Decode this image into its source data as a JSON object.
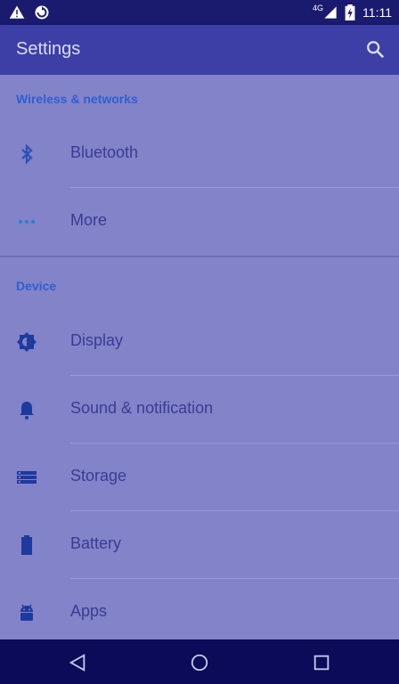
{
  "status_bar": {
    "network": "4G",
    "time": "11:11"
  },
  "app_bar": {
    "title": "Settings"
  },
  "sections": {
    "wireless": {
      "header": "Wireless & networks",
      "items": [
        {
          "label": "Bluetooth",
          "icon": "bluetooth-icon"
        },
        {
          "label": "More",
          "icon": "more-icon"
        }
      ]
    },
    "device": {
      "header": "Device",
      "items": [
        {
          "label": "Display",
          "icon": "display-icon"
        },
        {
          "label": "Sound & notification",
          "icon": "bell-icon"
        },
        {
          "label": "Storage",
          "icon": "storage-icon"
        },
        {
          "label": "Battery",
          "icon": "battery-icon"
        },
        {
          "label": "Apps",
          "icon": "android-icon"
        }
      ]
    }
  },
  "colors": {
    "accent": "#2f5fd0",
    "app_bar": "#3d3fa6",
    "nav_bar": "#0b0b5a"
  }
}
